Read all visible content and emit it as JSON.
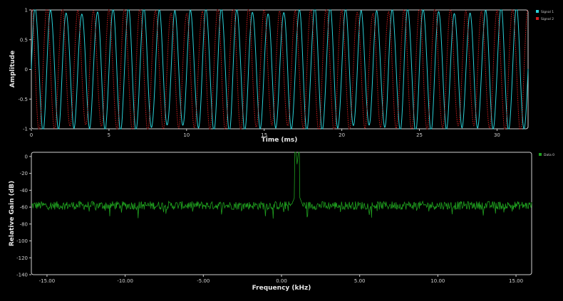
{
  "chart_data": [
    {
      "type": "line",
      "title": "",
      "xlabel": "Time (ms)",
      "ylabel": "Amplitude",
      "xlim": [
        0,
        32
      ],
      "ylim": [
        -1,
        1
      ],
      "x_ticks": [
        0,
        5,
        10,
        15,
        20,
        25,
        30
      ],
      "x_tick_labels": [
        "0",
        "5",
        "10",
        "15",
        "20",
        "25",
        "30"
      ],
      "y_ticks": [
        -1,
        -0.5,
        0,
        0.5,
        1
      ],
      "y_tick_labels": [
        "-1",
        "-0.5",
        "0",
        "0.5",
        "1"
      ],
      "grid": false,
      "legend_position": "right",
      "series": [
        {
          "name": "Signal 1",
          "color": "#2ad1d8",
          "style": "solid",
          "frequency_khz": 1.0,
          "phase_deg": 0,
          "amplitude": 1
        },
        {
          "name": "Signal 2",
          "color": "#d11e1e",
          "style": "dotted",
          "frequency_khz": 1.0,
          "phase_deg": 90,
          "amplitude": 1
        }
      ]
    },
    {
      "type": "line",
      "title": "",
      "xlabel": "Frequency (kHz)",
      "ylabel": "Relative Gain (dB)",
      "xlim": [
        -16,
        16
      ],
      "ylim": [
        -140,
        5
      ],
      "x_ticks": [
        -15,
        -10,
        -5,
        0,
        5,
        10,
        15
      ],
      "x_tick_labels": [
        "-15.00",
        "-10.00",
        "-5.00",
        "0.00",
        "5.00",
        "10.00",
        "15.00"
      ],
      "y_ticks": [
        0,
        -20,
        -40,
        -60,
        -80,
        -100,
        -120,
        -140
      ],
      "y_tick_labels": [
        "0",
        "-20",
        "-40",
        "-60",
        "-80",
        "-100",
        "-120",
        "-140"
      ],
      "grid": false,
      "legend_position": "right",
      "noise_floor_db": -58,
      "peak": {
        "x": 1.0,
        "y": -10
      },
      "series": [
        {
          "name": "Data 0",
          "color": "#1fa01f"
        }
      ]
    }
  ]
}
